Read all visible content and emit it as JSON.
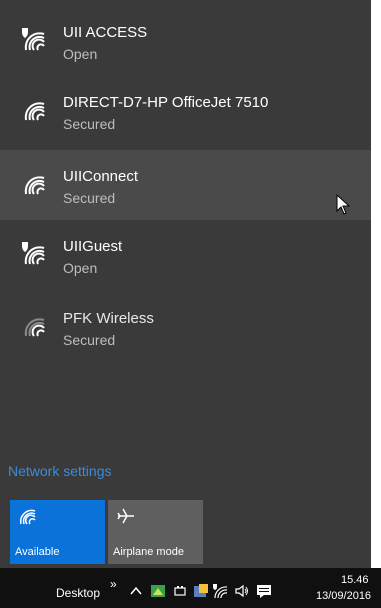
{
  "networks": [
    {
      "ssid": "UII ACCESS",
      "status": "Open",
      "icon": "wifi-open-shield-icon"
    },
    {
      "ssid": "DIRECT-D7-HP OfficeJet 7510",
      "status": "Secured",
      "icon": "wifi-icon"
    },
    {
      "ssid": "UIIConnect",
      "status": "Secured",
      "icon": "wifi-icon"
    },
    {
      "ssid": "UIIGuest",
      "status": "Open",
      "icon": "wifi-open-shield-icon"
    },
    {
      "ssid": "PFK Wireless",
      "status": "Secured",
      "icon": "wifi-weak-icon"
    }
  ],
  "network_settings_label": "Network settings",
  "tiles": {
    "available_label": "Available",
    "airplane_label": "Airplane mode"
  },
  "taskbar": {
    "desktop_label": "Desktop",
    "chevron": "»",
    "time": "15.46",
    "date": "13/09/2016"
  },
  "colors": {
    "flyout_bg": "#3a3a3a",
    "hover_bg": "#4a4a4a",
    "accent": "#0a72d8",
    "link": "#3b8cde"
  }
}
